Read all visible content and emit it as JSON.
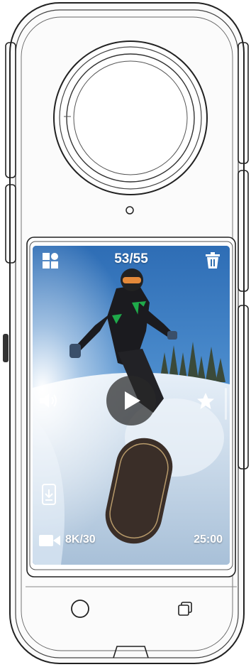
{
  "playback": {
    "counter": "53/55",
    "resolution": "8K/30",
    "duration": "25:00"
  },
  "icons": {
    "grid": "grid-view-icon",
    "trash": "trash-icon",
    "volume": "volume-icon",
    "star": "favorite-star-icon",
    "play": "play-icon",
    "download": "download-icon",
    "video": "video-camera-icon",
    "home": "home-circle-icon",
    "recent": "recent-apps-icon"
  },
  "colors": {
    "overlay_text": "#ffffff",
    "play_bg": "#2b2b2b",
    "device_outline": "#222222"
  }
}
